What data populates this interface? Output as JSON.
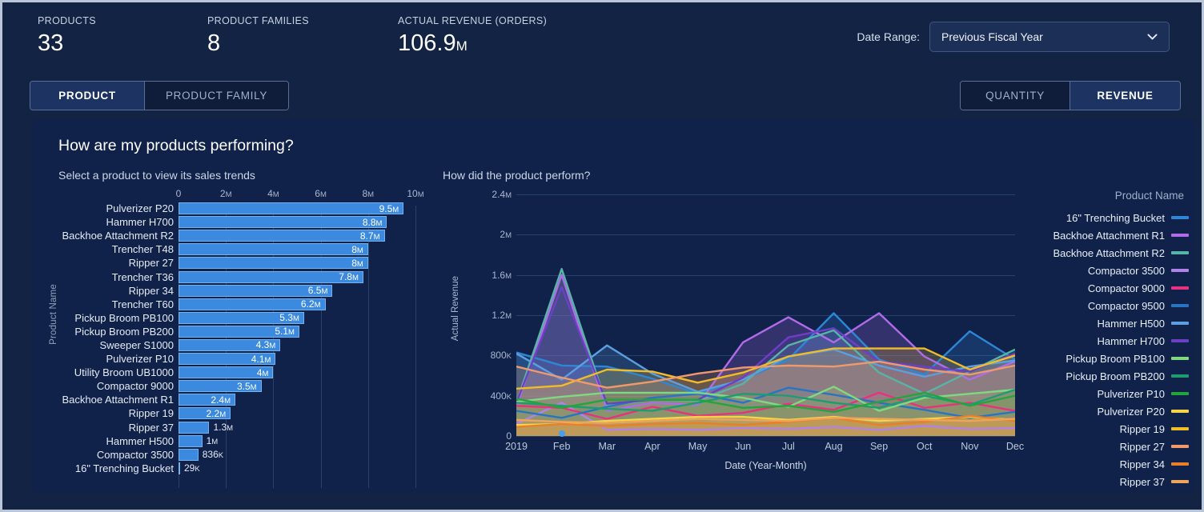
{
  "kpis": [
    {
      "label": "PRODUCTS",
      "value": "33",
      "unit": ""
    },
    {
      "label": "PRODUCT FAMILIES",
      "value": "8",
      "unit": ""
    },
    {
      "label": "ACTUAL REVENUE (ORDERS)",
      "value": "106.9",
      "unit": "M"
    }
  ],
  "date_range": {
    "label": "Date Range:",
    "value": "Previous Fiscal Year",
    "icon": "chevron-down-icon"
  },
  "tabs_left": [
    {
      "label": "PRODUCT",
      "active": true
    },
    {
      "label": "PRODUCT FAMILY",
      "active": false
    }
  ],
  "tabs_right": [
    {
      "label": "QUANTITY",
      "active": false
    },
    {
      "label": "REVENUE",
      "active": true
    }
  ],
  "panel": {
    "title": "How are my products performing?",
    "subtitle_left": "Select a product to view its sales trends",
    "subtitle_right": "How did the product perform?"
  },
  "colors": {
    "background": "#132344",
    "panel": "#11224a",
    "bar_fill": "#3b8ae0",
    "bar_stroke": "#76b1ec",
    "accent": "#b9c6d8",
    "active_tab": "#1d3463"
  },
  "chart_data": [
    {
      "type": "bar",
      "id": "product-revenue-bar",
      "title": "Select a product to view its sales trends",
      "xlabel": "",
      "ylabel": "Product Name",
      "orientation": "horizontal",
      "xlim": [
        0,
        10000000
      ],
      "xticks": [
        "0",
        "2M",
        "4M",
        "6M",
        "8M",
        "10M"
      ],
      "xtick_values": [
        0,
        2000000,
        4000000,
        6000000,
        8000000,
        10000000
      ],
      "grid": true,
      "categories": [
        "Pulverizer P20",
        "Hammer H700",
        "Backhoe Attachment R2",
        "Trencher T48",
        "Ripper 27",
        "Trencher T36",
        "Ripper 34",
        "Trencher T60",
        "Pickup Broom PB100",
        "Pickup Broom PB200",
        "Sweeper S1000",
        "Pulverizer P10",
        "Utility Broom UB1000",
        "Compactor 9000",
        "Backhoe Attachment R1",
        "Ripper 19",
        "Ripper 37",
        "Hammer H500",
        "Compactor 3500",
        "16\" Trenching Bucket"
      ],
      "values": [
        9500000,
        8800000,
        8700000,
        8000000,
        8000000,
        7800000,
        6500000,
        6200000,
        5300000,
        5100000,
        4300000,
        4100000,
        4000000,
        3500000,
        2400000,
        2200000,
        1300000,
        1000000,
        836000,
        29000
      ],
      "value_labels": [
        "9.5M",
        "8.8M",
        "8.7M",
        "8M",
        "8M",
        "7.8M",
        "6.5M",
        "6.2M",
        "5.3M",
        "5.1M",
        "4.3M",
        "4.1M",
        "4M",
        "3.5M",
        "2.4M",
        "2.2M",
        "1.3M",
        "1M",
        "836K",
        "29K"
      ],
      "clipped_top": true
    },
    {
      "type": "area",
      "id": "product-trend-lines",
      "title": "How did the product perform?",
      "xlabel": "Date (Year-Month)",
      "ylabel": "Actual Revenue",
      "ylim": [
        0,
        2400000
      ],
      "yticks": [
        "0",
        "400K",
        "800K",
        "1.2M",
        "1.6M",
        "2M",
        "2.4M"
      ],
      "ytick_values": [
        0,
        400000,
        800000,
        1200000,
        1600000,
        2000000,
        2400000
      ],
      "x": [
        "2019",
        "Feb",
        "Mar",
        "Apr",
        "May",
        "Jun",
        "Jul",
        "Aug",
        "Sep",
        "Oct",
        "Nov",
        "Dec"
      ],
      "grid": true,
      "legend_position": "right",
      "legend_title": "Product Name",
      "selected_marker": {
        "x": "Feb",
        "y": 20000
      },
      "series": [
        {
          "name": "16\" Trenching Bucket",
          "color": "#2e86d6",
          "values": [
            830000,
            700000,
            690000,
            570000,
            420000,
            560000,
            760000,
            1220000,
            760000,
            610000,
            1040000,
            760000
          ]
        },
        {
          "name": "Backhoe Attachment R1",
          "color": "#b06ce8",
          "values": [
            290000,
            1600000,
            250000,
            330000,
            310000,
            930000,
            1180000,
            930000,
            1220000,
            790000,
            560000,
            740000
          ]
        },
        {
          "name": "Backhoe Attachment R2",
          "color": "#56b5a6",
          "values": [
            330000,
            1660000,
            300000,
            360000,
            350000,
            520000,
            900000,
            1050000,
            630000,
            420000,
            640000,
            860000
          ]
        },
        {
          "name": "Compactor 3500",
          "color": "#b183e8",
          "values": [
            120000,
            330000,
            60000,
            70000,
            60000,
            80000,
            70000,
            90000,
            60000,
            100000,
            70000,
            80000
          ]
        },
        {
          "name": "Compactor 9000",
          "color": "#e8317f",
          "values": [
            300000,
            280000,
            170000,
            290000,
            200000,
            230000,
            320000,
            260000,
            430000,
            280000,
            330000,
            250000
          ]
        },
        {
          "name": "Compactor 9500",
          "color": "#2874c4",
          "values": [
            250000,
            180000,
            290000,
            380000,
            420000,
            330000,
            480000,
            410000,
            330000,
            260000,
            180000,
            240000
          ]
        },
        {
          "name": "Hammer H500",
          "color": "#5c9fe0",
          "values": [
            820000,
            560000,
            900000,
            620000,
            440000,
            560000,
            790000,
            860000,
            700000,
            590000,
            690000,
            750000
          ]
        },
        {
          "name": "Hammer H700",
          "color": "#6d3fc4",
          "values": [
            330000,
            1480000,
            320000,
            360000,
            360000,
            580000,
            980000,
            1070000,
            740000,
            690000,
            640000,
            820000
          ]
        },
        {
          "name": "Pickup Broom PB100",
          "color": "#7fd882",
          "values": [
            340000,
            390000,
            430000,
            430000,
            430000,
            380000,
            290000,
            490000,
            250000,
            380000,
            420000,
            460000
          ]
        },
        {
          "name": "Pickup Broom PB200",
          "color": "#1d9d6f",
          "values": [
            330000,
            300000,
            270000,
            250000,
            330000,
            420000,
            400000,
            330000,
            280000,
            400000,
            310000,
            460000
          ]
        },
        {
          "name": "Pulverizer P10",
          "color": "#23a53d",
          "values": [
            370000,
            280000,
            360000,
            360000,
            360000,
            280000,
            300000,
            240000,
            340000,
            430000,
            300000,
            400000
          ]
        },
        {
          "name": "Pulverizer P20",
          "color": "#f5d547",
          "values": [
            110000,
            120000,
            150000,
            170000,
            190000,
            190000,
            160000,
            190000,
            150000,
            170000,
            190000,
            160000
          ]
        },
        {
          "name": "Ripper 19",
          "color": "#f0bc28",
          "values": [
            470000,
            500000,
            660000,
            640000,
            530000,
            630000,
            790000,
            870000,
            870000,
            870000,
            660000,
            800000
          ]
        },
        {
          "name": "Ripper 27",
          "color": "#f09a6b",
          "values": [
            690000,
            580000,
            480000,
            540000,
            620000,
            680000,
            700000,
            690000,
            740000,
            660000,
            610000,
            700000
          ]
        },
        {
          "name": "Ripper 34",
          "color": "#ea7f2a",
          "values": [
            90000,
            120000,
            100000,
            120000,
            130000,
            110000,
            140000,
            180000,
            110000,
            140000,
            200000,
            150000
          ]
        },
        {
          "name": "Ripper 37",
          "color": "#f0a35a",
          "values": [
            160000,
            140000,
            130000,
            150000,
            170000,
            160000,
            150000,
            180000,
            170000,
            160000,
            150000,
            170000
          ]
        }
      ]
    }
  ]
}
